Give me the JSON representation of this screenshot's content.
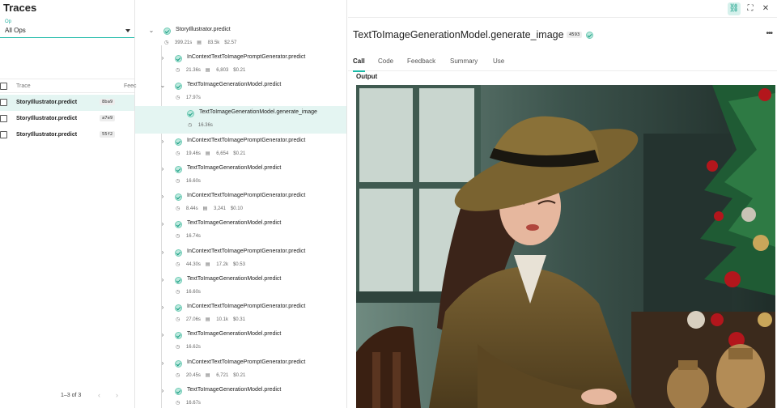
{
  "left": {
    "title": "Traces",
    "op_label": "Op",
    "op_value": "All Ops",
    "col_trace": "Trace",
    "col_feedback": "Feec",
    "rows": [
      {
        "name": "StoryIllustrator.predict",
        "hash": "8ba9",
        "selected": true
      },
      {
        "name": "StoryIllustrator.predict",
        "hash": "a7e9",
        "selected": false
      },
      {
        "name": "StoryIllustrator.predict",
        "hash": "55f2",
        "selected": false
      }
    ],
    "pagination": "1–3 of 3"
  },
  "tree": [
    {
      "name": "StoryIllustrator.predict",
      "time": "399.21s",
      "tokens": "83.5k",
      "cost": "$2.57",
      "expanded": true
    },
    {
      "name": "InContextTextToImagePromptGenerator.predict",
      "time": "21.36s",
      "tokens": "6,803",
      "cost": "$0.21"
    },
    {
      "name": "TextToImageGenerationModel.predict",
      "time": "17.97s",
      "expanded": true
    },
    {
      "name": "TextToImageGenerationModel.generate_image",
      "time": "16.36s",
      "selected": true
    },
    {
      "name": "InContextTextToImagePromptGenerator.predict",
      "time": "19.46s",
      "tokens": "6,654",
      "cost": "$0.21"
    },
    {
      "name": "TextToImageGenerationModel.predict",
      "time": "16.60s"
    },
    {
      "name": "InContextTextToImagePromptGenerator.predict",
      "time": "8.44s",
      "tokens": "3,241",
      "cost": "$0.10"
    },
    {
      "name": "TextToImageGenerationModel.predict",
      "time": "16.74s"
    },
    {
      "name": "InContextTextToImagePromptGenerator.predict",
      "time": "44.30s",
      "tokens": "17.2k",
      "cost": "$0.53"
    },
    {
      "name": "TextToImageGenerationModel.predict",
      "time": "16.60s"
    },
    {
      "name": "InContextTextToImagePromptGenerator.predict",
      "time": "27.06s",
      "tokens": "10.1k",
      "cost": "$0.31"
    },
    {
      "name": "TextToImageGenerationModel.predict",
      "time": "16.62s"
    },
    {
      "name": "InContextTextToImagePromptGenerator.predict",
      "time": "20.45s",
      "tokens": "6,721",
      "cost": "$0.21"
    },
    {
      "name": "TextToImageGenerationModel.predict",
      "time": "16.67s"
    }
  ],
  "detail": {
    "title": "TextToImageGenerationModel.generate_image",
    "badge": "4593",
    "tabs": [
      "Call",
      "Code",
      "Feedback",
      "Summary",
      "Use"
    ],
    "active_tab": "Call",
    "output_label": "Output"
  },
  "colors": {
    "accent": "#19b9a6",
    "selected_bg": "#e4f5f2"
  },
  "icons": {
    "status": "check-circle-icon",
    "time": "clock-icon",
    "tokens": "database-icon"
  }
}
